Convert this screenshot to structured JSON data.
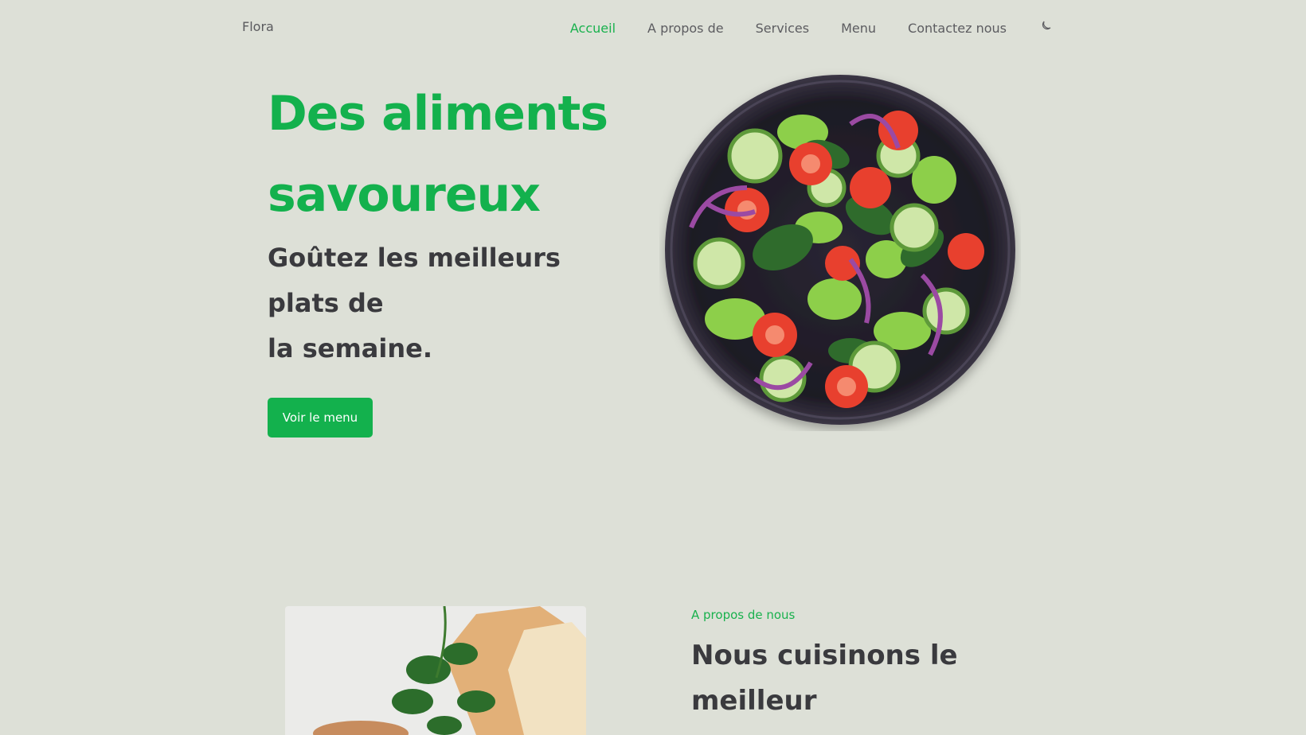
{
  "nav": {
    "logo": "Flora",
    "links": [
      "Accueil",
      "A propos de",
      "Services",
      "Menu",
      "Contactez nous"
    ],
    "active_link": "Accueil",
    "theme_icon": "moon-icon"
  },
  "hero": {
    "title": "Des aliments savoureux",
    "subtitle_lines": [
      "Goûtez les meilleurs",
      "plats de",
      "la semaine."
    ],
    "cta_label": "Voir le menu",
    "image": "salad-bowl-image"
  },
  "about": {
    "kicker": "A propos de nous",
    "title": "Nous cuisinons le meilleur",
    "image": "ingredients-image"
  },
  "colors": {
    "background": "#dde0d7",
    "accent": "#13b14d",
    "text_dark": "#3a3a3e",
    "nav_text": "#5c5c60"
  }
}
